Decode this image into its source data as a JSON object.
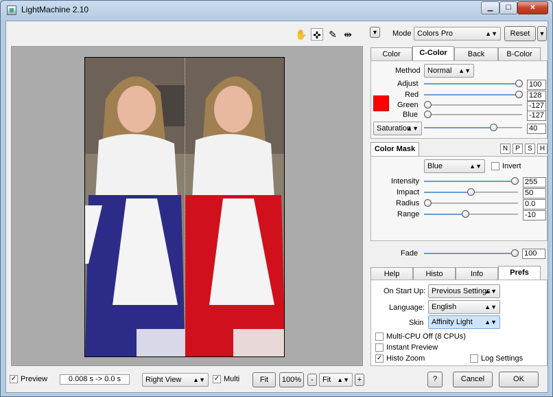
{
  "window": {
    "title": "LightMachine 2.10"
  },
  "toolbar": {
    "icons": [
      "hand-icon",
      "crosshair-icon",
      "eyedropper-icon",
      "split-compare-icon"
    ]
  },
  "mode": {
    "label": "Mode",
    "value": "Colors Pro",
    "reset": "Reset"
  },
  "color_tabs": [
    "Color",
    "C-Color",
    "Back",
    "B-Color"
  ],
  "ccolor": {
    "method_label": "Method",
    "method_value": "Normal",
    "swatch_color": "#ff0000",
    "adjust": {
      "label": "Adjust",
      "value": "100"
    },
    "red": {
      "label": "Red",
      "value": "128"
    },
    "green": {
      "label": "Green",
      "value": "-127"
    },
    "blue": {
      "label": "Blue",
      "value": "-127"
    },
    "saturation": {
      "label": "Saturation",
      "value": "40"
    }
  },
  "mask": {
    "title": "Color Mask",
    "buttons": [
      "N",
      "P",
      "S",
      "H"
    ],
    "channel": "Blue",
    "invert": "Invert",
    "intensity": {
      "label": "Intensity",
      "value": "255"
    },
    "impact": {
      "label": "Impact",
      "value": "50"
    },
    "radius": {
      "label": "Radius",
      "value": "0.0"
    },
    "range": {
      "label": "Range",
      "value": "-10"
    }
  },
  "fade": {
    "label": "Fade",
    "value": "100"
  },
  "bottom_tabs": [
    "Help",
    "Histo",
    "Info",
    "Prefs"
  ],
  "prefs": {
    "startup_label": "On Start Up:",
    "startup_value": "Previous Settings",
    "language_label": "Language:",
    "language_value": "English",
    "skin_label": "Skin",
    "skin_value": "Affinity Light",
    "multicpu": "Multi-CPU Off (8 CPUs)",
    "instant_preview": "Instant Preview",
    "histo_zoom": "Histo Zoom",
    "log_settings": "Log Settings"
  },
  "footer": {
    "preview": "Preview",
    "timing": "0.008 s -> 0.0 s",
    "view": "Right View",
    "multi": "Multi",
    "fit": "Fit",
    "zoom": "100%",
    "minus": "-",
    "fit_combo": "Fit",
    "plus": "+",
    "help": "?",
    "cancel": "Cancel",
    "ok": "OK"
  }
}
